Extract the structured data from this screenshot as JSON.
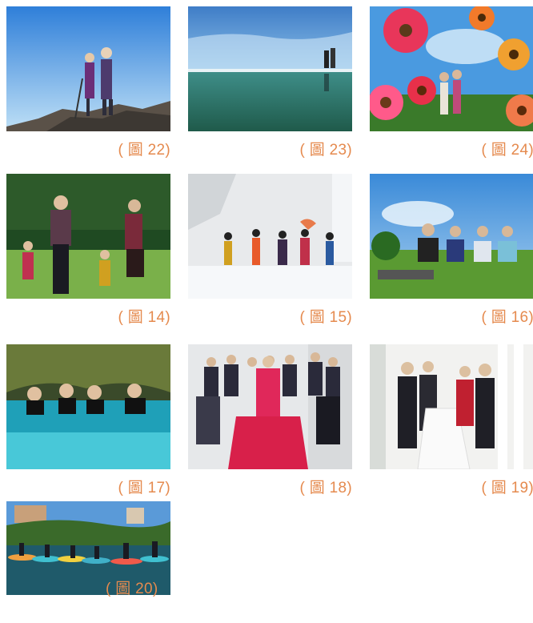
{
  "captions": {
    "c22": "( 圖 22)",
    "c23": "( 圖 23)",
    "c24": "( 圖 24)",
    "c14": "( 圖 14)",
    "c15": "( 圖 15)",
    "c16": "( 圖 16)",
    "c17": "( 圖 17)",
    "c18": "( 圖 18)",
    "c19": "( 圖 19)",
    "c20": "( 圖 20)"
  },
  "photos": [
    "mountain-hikers-photo",
    "reflection-lake-photo",
    "flower-field-photo",
    "family-park-photo",
    "ski-slope-photo",
    "group-sitting-grass-photo",
    "cave-swimming-photo",
    "wedding-group-photo",
    "wedding-hall-photo",
    "paddleboard-lake-photo"
  ],
  "colors": {
    "caption": "#e58a4e"
  }
}
